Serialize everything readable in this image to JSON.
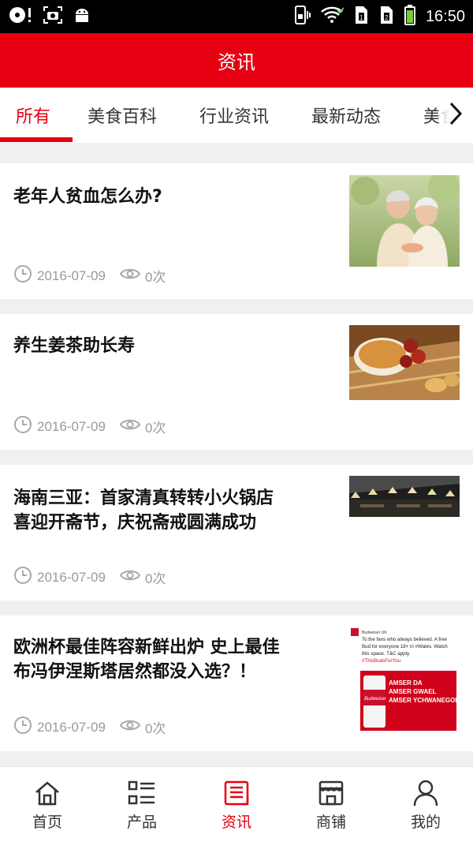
{
  "status_bar": {
    "time": "16:50",
    "left_icons": [
      "cd-icon",
      "screenshot-icon",
      "android-icon"
    ],
    "right_icons": [
      "vibrate-icon",
      "wifi-icon",
      "sim1-icon",
      "sim2-icon",
      "battery-icon"
    ]
  },
  "header": {
    "title": "资讯"
  },
  "colors": {
    "accent": "#e60012",
    "meta": "#9a9a9a"
  },
  "tabs": [
    {
      "label": "所有",
      "active": true
    },
    {
      "label": "美食百科"
    },
    {
      "label": "行业资讯"
    },
    {
      "label": "最新动态"
    },
    {
      "label": "美食"
    }
  ],
  "articles": [
    {
      "title_lines": [
        "老年人贫血怎么办?"
      ],
      "date": "2016-07-09",
      "views": "0次",
      "thumb": "elderly-couple-photo"
    },
    {
      "title_lines": [
        "养生姜茶助长寿"
      ],
      "date": "2016-07-09",
      "views": "0次",
      "thumb": "ginger-tea-photo"
    },
    {
      "title_lines": [
        "海南三亚：首家清真转转小火锅店",
        "喜迎开斋节，庆祝斋戒圆满成功"
      ],
      "date": "2016-07-09",
      "views": "0次",
      "thumb": "restaurant-interior-photo"
    },
    {
      "title_lines": [
        "欧洲杯最佳阵容新鲜出炉 史上最佳",
        "布冯伊涅斯塔居然都没入选？！"
      ],
      "date": "2016-07-09",
      "views": "0次",
      "thumb": "tweet-screenshot",
      "thumb_text": {
        "tweet_line1": "To the fans who always believed. A free",
        "tweet_line2": "Bud for everyone 18+ in #Wales. Watch",
        "tweet_line3": "this space. T&C apply.",
        "hashtag": "#ThisBudsForYou",
        "ad_line1": "AMSER DA",
        "ad_line2": "AMSER GWAEL",
        "ad_line3": "AMSER YCHWANEGOL",
        "brand": "Budweiser"
      }
    }
  ],
  "bottom_nav": [
    {
      "label": "首页",
      "icon": "home-icon"
    },
    {
      "label": "产品",
      "icon": "list-icon"
    },
    {
      "label": "资讯",
      "icon": "news-icon",
      "active": true
    },
    {
      "label": "商铺",
      "icon": "store-icon"
    },
    {
      "label": "我的",
      "icon": "user-icon"
    }
  ]
}
